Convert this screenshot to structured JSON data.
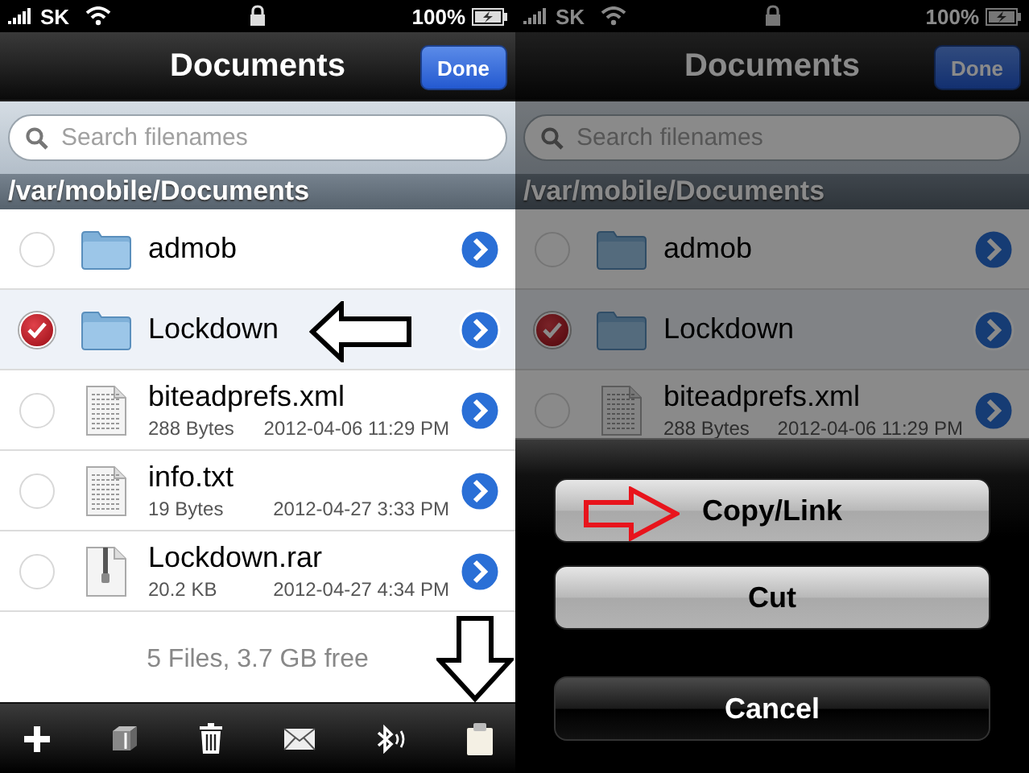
{
  "screens": [
    {
      "dimmed": false,
      "status_bar": {
        "carrier": "SK",
        "battery": "100%"
      },
      "nav": {
        "title": "Documents",
        "button": "Done"
      },
      "search": {
        "placeholder": "Search filenames"
      },
      "path": "/var/mobile/Documents",
      "files": [
        {
          "name": "admob",
          "kind": "folder",
          "selected": false
        },
        {
          "name": "Lockdown",
          "kind": "folder",
          "selected": true
        },
        {
          "name": "biteadprefs.xml",
          "kind": "document",
          "selected": false,
          "size": "288 Bytes",
          "date": "2012-04-06 11:29 PM"
        },
        {
          "name": "info.txt",
          "kind": "document",
          "selected": false,
          "size": "19 Bytes",
          "date": "2012-04-27 3:33 PM"
        },
        {
          "name": "Lockdown.rar",
          "kind": "archive",
          "selected": false,
          "size": "20.2 KB",
          "date": "2012-04-27 4:34 PM"
        }
      ],
      "footer": "5 Files, 3.7 GB free"
    },
    {
      "dimmed": true,
      "status_bar": {
        "carrier": "SK",
        "battery": "100%"
      },
      "nav": {
        "title": "Documents",
        "button": "Done"
      },
      "search": {
        "placeholder": "Search filenames"
      },
      "path": "/var/mobile/Documents",
      "files": [
        {
          "name": "admob",
          "kind": "folder",
          "selected": false
        },
        {
          "name": "Lockdown",
          "kind": "folder",
          "selected": true
        },
        {
          "name": "biteadprefs.xml",
          "kind": "document",
          "selected": false,
          "size": "288 Bytes",
          "date": "2012-04-06 11:29 PM"
        }
      ],
      "action_sheet": {
        "buttons": [
          {
            "label": "Copy/Link",
            "kind": "default"
          },
          {
            "label": "Cut",
            "kind": "default"
          },
          {
            "label": "Cancel",
            "kind": "cancel"
          }
        ]
      }
    }
  ]
}
